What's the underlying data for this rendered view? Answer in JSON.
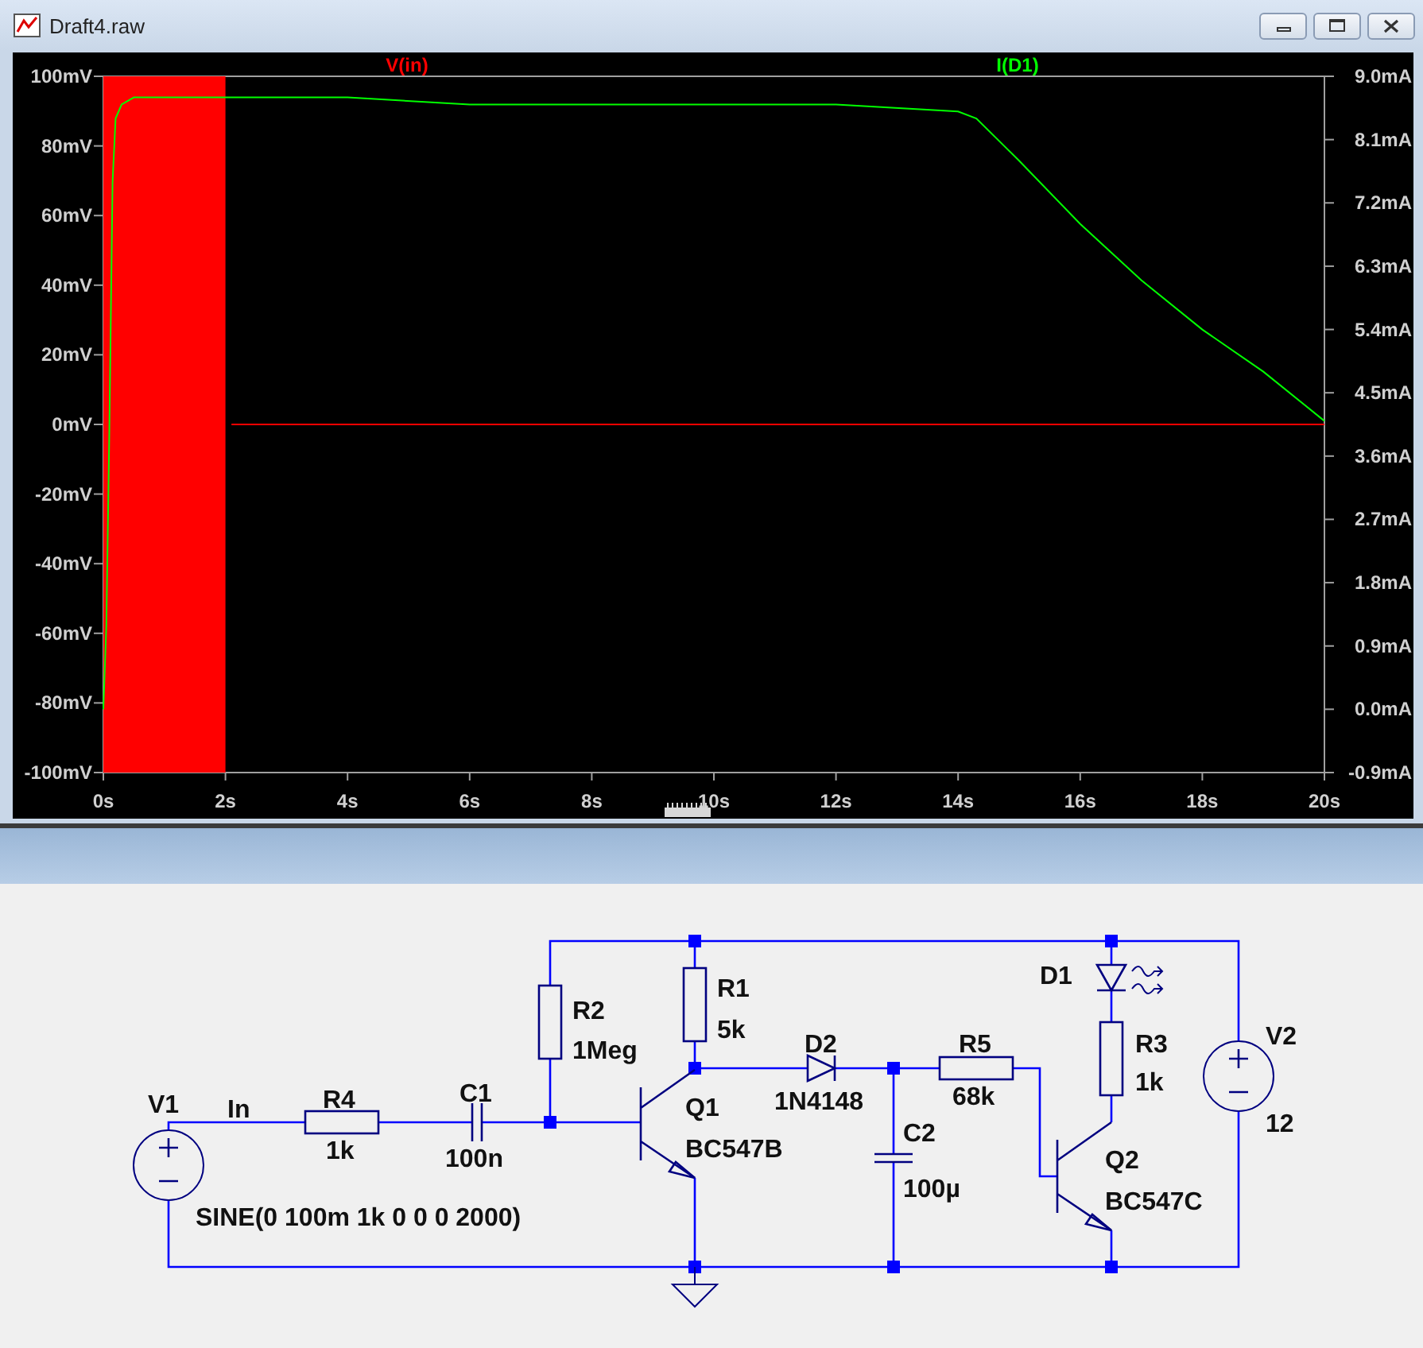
{
  "window": {
    "title": "Draft4.raw"
  },
  "plot": {
    "chart_data": {
      "type": "line",
      "x": [
        0,
        0.05,
        0.1,
        0.15,
        0.2,
        0.3,
        0.5,
        1,
        2,
        2.1,
        4,
        6,
        8,
        10,
        12,
        14,
        14.3,
        15,
        16,
        17,
        18,
        19,
        20
      ],
      "xlim": [
        0,
        20
      ],
      "ylim": [
        -100,
        100
      ],
      "y2lim": [
        -0.9,
        9.0
      ],
      "xticks": [
        {
          "value": 0,
          "label": "0s"
        },
        {
          "value": 2,
          "label": "2s"
        },
        {
          "value": 4,
          "label": "4s"
        },
        {
          "value": 6,
          "label": "6s"
        },
        {
          "value": 8,
          "label": "8s"
        },
        {
          "value": 10,
          "label": "10s"
        },
        {
          "value": 12,
          "label": "12s"
        },
        {
          "value": 14,
          "label": "14s"
        },
        {
          "value": 16,
          "label": "16s"
        },
        {
          "value": 18,
          "label": "18s"
        },
        {
          "value": 20,
          "label": "20s"
        }
      ],
      "yticks": [
        {
          "value": 100,
          "label": "100mV"
        },
        {
          "value": 80,
          "label": "80mV"
        },
        {
          "value": 60,
          "label": "60mV"
        },
        {
          "value": 40,
          "label": "40mV"
        },
        {
          "value": 20,
          "label": "20mV"
        },
        {
          "value": 0,
          "label": "0mV"
        },
        {
          "value": -20,
          "label": "-20mV"
        },
        {
          "value": -40,
          "label": "-40mV"
        },
        {
          "value": -60,
          "label": "-60mV"
        },
        {
          "value": -80,
          "label": "-80mV"
        },
        {
          "value": -100,
          "label": "-100mV"
        }
      ],
      "y2ticks": [
        {
          "value": 9.0,
          "label": "9.0mA"
        },
        {
          "value": 8.1,
          "label": "8.1mA"
        },
        {
          "value": 7.2,
          "label": "7.2mA"
        },
        {
          "value": 6.3,
          "label": "6.3mA"
        },
        {
          "value": 5.4,
          "label": "5.4mA"
        },
        {
          "value": 4.5,
          "label": "4.5mA"
        },
        {
          "value": 3.6,
          "label": "3.6mA"
        },
        {
          "value": 2.7,
          "label": "2.7mA"
        },
        {
          "value": 1.8,
          "label": "1.8mA"
        },
        {
          "value": 0.9,
          "label": "0.9mA"
        },
        {
          "value": 0.0,
          "label": "0.0mA"
        },
        {
          "value": -0.9,
          "label": "-0.9mA"
        }
      ],
      "series": [
        {
          "name": "V(in)",
          "color": "#ff0000",
          "values": [
            null,
            null,
            null,
            null,
            null,
            null,
            null,
            null,
            null,
            0,
            0,
            0,
            0,
            0,
            0,
            0,
            0,
            0,
            0,
            0,
            0,
            0,
            0
          ]
        },
        {
          "name": "I(D1)",
          "color": "#00ff00",
          "axis": "y2",
          "values": [
            0.0,
            1.2,
            4.0,
            7.5,
            8.4,
            8.6,
            8.7,
            8.7,
            8.7,
            8.7,
            8.7,
            8.6,
            8.6,
            8.6,
            8.6,
            8.5,
            8.4,
            7.8,
            6.9,
            6.1,
            5.4,
            4.8,
            4.1
          ]
        }
      ]
    }
  },
  "schematic": {
    "components": [
      {
        "kind": "source",
        "name": "V1",
        "value": "SINE(0 100m 1k 0 0 0 2000)"
      },
      {
        "kind": "net_label",
        "name": "In"
      },
      {
        "kind": "resistor",
        "name": "R4",
        "value": "1k"
      },
      {
        "kind": "capacitor",
        "name": "C1",
        "value": "100n"
      },
      {
        "kind": "resistor",
        "name": "R2",
        "value": "1Meg"
      },
      {
        "kind": "resistor",
        "name": "R1",
        "value": "5k"
      },
      {
        "kind": "transistor",
        "name": "Q1",
        "value": "BC547B"
      },
      {
        "kind": "diode",
        "name": "D2",
        "value": "1N4148"
      },
      {
        "kind": "capacitor",
        "name": "C2",
        "value": "100µ"
      },
      {
        "kind": "resistor",
        "name": "R5",
        "value": "68k"
      },
      {
        "kind": "led",
        "name": "D1"
      },
      {
        "kind": "resistor",
        "name": "R3",
        "value": "1k"
      },
      {
        "kind": "transistor",
        "name": "Q2",
        "value": "BC547C"
      },
      {
        "kind": "source",
        "name": "V2",
        "value": "12"
      }
    ]
  }
}
